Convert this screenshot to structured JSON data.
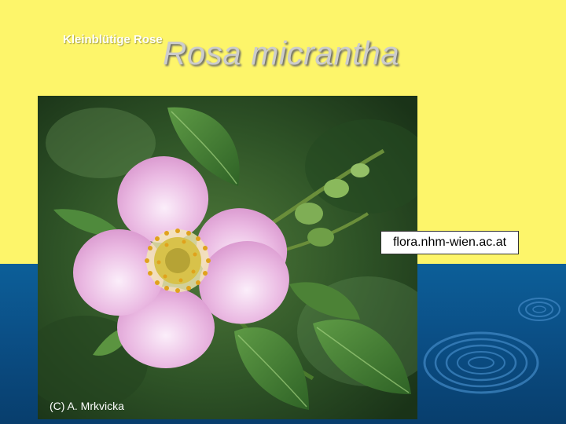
{
  "slide": {
    "subtitle": "Kleinblütige Rose",
    "title": "Rosa micrantha",
    "source_label": "flora.nhm-wien.ac.at",
    "photo_credit": "(C) A. Mrkvicka"
  },
  "colors": {
    "top_background": "#fdf56a",
    "bottom_background": "#0b4f86",
    "title_text": "#cccccc",
    "title_shadow": "#6b6b6b"
  },
  "photo": {
    "subject": "pink wild rose flower with leaves",
    "icons": [
      "rose-flower-icon",
      "ripple-rings-icon"
    ]
  }
}
